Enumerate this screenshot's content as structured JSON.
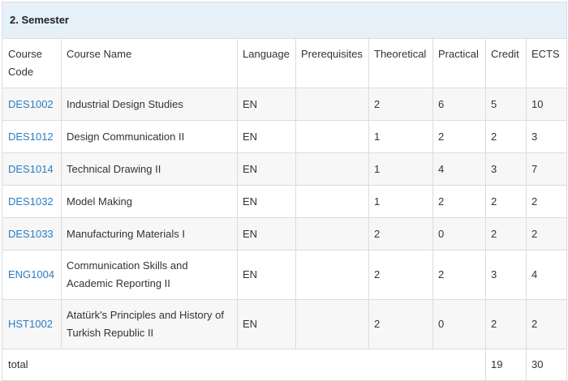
{
  "semester": {
    "title": "2. Semester"
  },
  "columns": {
    "code": "Course Code",
    "name": "Course Name",
    "language": "Language",
    "prerequisites": "Prerequisites",
    "theoretical": "Theoretical",
    "practical": "Practical",
    "credit": "Credit",
    "ects": "ECTS"
  },
  "courses": [
    {
      "code": "DES1002",
      "name": "Industrial Design Studies",
      "language": "EN",
      "prerequisites": "",
      "theoretical": "2",
      "practical": "6",
      "credit": "5",
      "ects": "10"
    },
    {
      "code": "DES1012",
      "name": "Design Communication II",
      "language": "EN",
      "prerequisites": "",
      "theoretical": "1",
      "practical": "2",
      "credit": "2",
      "ects": "3"
    },
    {
      "code": "DES1014",
      "name": "Technical Drawing II",
      "language": "EN",
      "prerequisites": "",
      "theoretical": "1",
      "practical": "4",
      "credit": "3",
      "ects": "7"
    },
    {
      "code": "DES1032",
      "name": "Model Making",
      "language": "EN",
      "prerequisites": "",
      "theoretical": "1",
      "practical": "2",
      "credit": "2",
      "ects": "2"
    },
    {
      "code": "DES1033",
      "name": "Manufacturing Materials I",
      "language": "EN",
      "prerequisites": "",
      "theoretical": "2",
      "practical": "0",
      "credit": "2",
      "ects": "2"
    },
    {
      "code": "ENG1004",
      "name": "Communication Skills and Academic Reporting II",
      "language": "EN",
      "prerequisites": "",
      "theoretical": "2",
      "practical": "2",
      "credit": "3",
      "ects": "4"
    },
    {
      "code": "HST1002",
      "name": "Atatürk's Principles and History of Turkish Republic II",
      "language": "EN",
      "prerequisites": "",
      "theoretical": "2",
      "practical": "0",
      "credit": "2",
      "ects": "2"
    }
  ],
  "total": {
    "label": "total",
    "credit": "19",
    "ects": "30"
  }
}
